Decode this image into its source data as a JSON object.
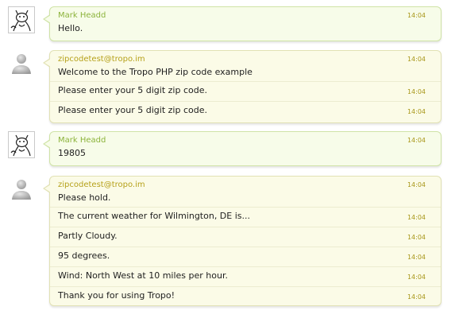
{
  "conversation": [
    {
      "sender": "Mark Headd",
      "type": "user",
      "avatar_icon": "cat-icon",
      "time": "14:04",
      "messages": [
        {
          "text": "Hello.",
          "time": ""
        }
      ]
    },
    {
      "sender": "zipcodetest@tropo.im",
      "type": "bot",
      "avatar_icon": "person-icon",
      "time": "14:04",
      "messages": [
        {
          "text": "Welcome to the Tropo PHP zip code example",
          "time": ""
        },
        {
          "text": "Please enter your 5 digit zip code.",
          "time": "14:04"
        },
        {
          "text": "Please enter your 5 digit zip code.",
          "time": "14:04"
        }
      ]
    },
    {
      "sender": "Mark Headd",
      "type": "user",
      "avatar_icon": "cat-icon",
      "time": "14:04",
      "messages": [
        {
          "text": "19805",
          "time": ""
        }
      ]
    },
    {
      "sender": "zipcodetest@tropo.im",
      "type": "bot",
      "avatar_icon": "person-icon",
      "time": "14:04",
      "messages": [
        {
          "text": "Please hold.",
          "time": ""
        },
        {
          "text": "The current weather for Wilmington, DE is...",
          "time": "14:04"
        },
        {
          "text": "Partly Cloudy.",
          "time": "14:04"
        },
        {
          "text": "95 degrees.",
          "time": "14:04"
        },
        {
          "text": "Wind: North West at 10 miles per hour.",
          "time": "14:04"
        },
        {
          "text": "Thank you for using Tropo!",
          "time": "14:04"
        }
      ]
    }
  ],
  "colors": {
    "user_bubble": "#f7fce9",
    "bot_bubble": "#fbfbe7",
    "user_name": "#8cb33b",
    "bot_name": "#b6a11a",
    "time": "#a89618"
  }
}
